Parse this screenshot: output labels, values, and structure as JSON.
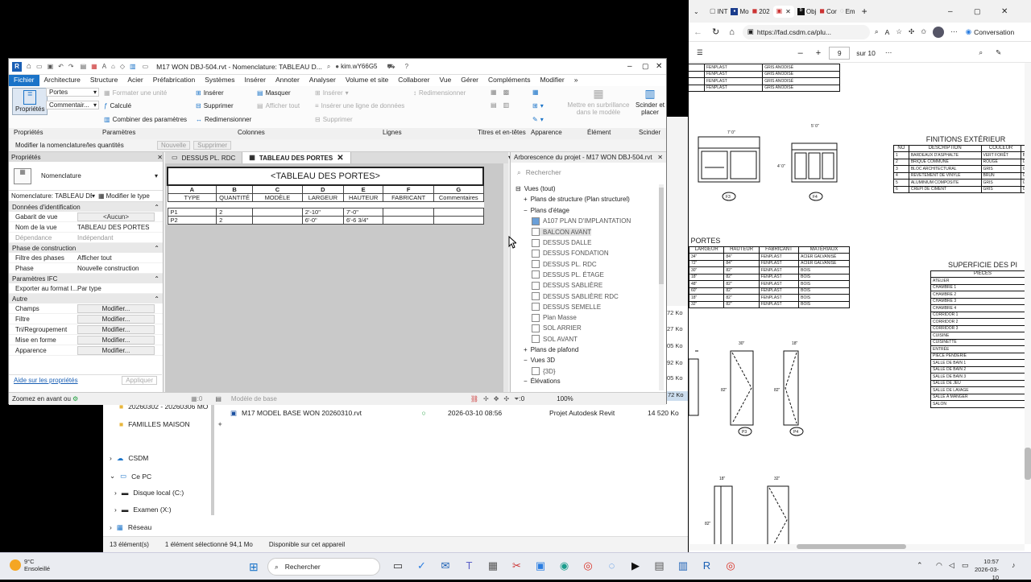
{
  "revit": {
    "title": "M17 WON DBJ-504.rvt - Nomenclature: TABLEAU D...",
    "user": "kim.wY66G5",
    "menu": [
      "Fichier",
      "Architecture",
      "Structure",
      "Acier",
      "Préfabrication",
      "Systèmes",
      "Insérer",
      "Annoter",
      "Analyser",
      "Volume et site",
      "Collaborer",
      "Vue",
      "Gérer",
      "Compléments",
      "Modifier"
    ],
    "ribbon": {
      "proprietes": "Propriétés",
      "portes": "Portes",
      "commentaires": "Commentair...",
      "formater_unite": "Formater une unité",
      "calcule": "Calculé",
      "combiner": "Combiner des paramètres",
      "inserer": "Insérer",
      "supprimer": "Supprimer",
      "redimensionner": "Redimensionner",
      "masquer": "Masquer",
      "afficher_tout": "Afficher tout",
      "inserer2": "Insérer",
      "inserer_ligne": "Insérer une ligne de données",
      "supprimer2": "Supprimer",
      "redimensionner2": "Redimensionner",
      "mettre_surbrillance": "Mettre en surbrillance dans le modèle",
      "scinder": "Scinder et placer"
    },
    "groups": [
      "Propriétés",
      "Paramètres",
      "Colonnes",
      "Lignes",
      "Titres et en-têtes",
      "Apparence",
      "Élément",
      "Scinder"
    ],
    "ctx": {
      "label": "Modifier la nomenclature/les quantités",
      "nouvelle": "Nouvelle",
      "supprimer": "Supprimer"
    },
    "props": {
      "header": "Propriétés",
      "type": "Nomenclature",
      "type_sel": "Nomenclature: TABLEAU DE",
      "modifier_type": "Modifier le type",
      "cats": [
        "Données d'identification",
        "Phase de construction",
        "Paramètres IFC",
        "Autre"
      ],
      "rows_id": [
        [
          "Gabarit de vue",
          "<Aucun>"
        ],
        [
          "Nom de la vue",
          "TABLEAU DES PORTES"
        ],
        [
          "Dépendance",
          "Indépendant"
        ]
      ],
      "rows_phase": [
        [
          "Filtre des phases",
          "Afficher tout"
        ],
        [
          "Phase",
          "Nouvelle construction"
        ]
      ],
      "rows_ifc": [
        [
          "Exporter au format I...",
          "Par type"
        ]
      ],
      "rows_autre": [
        [
          "Champs",
          "Modifier..."
        ],
        [
          "Filtre",
          "Modifier..."
        ],
        [
          "Tri/Regroupement",
          "Modifier..."
        ],
        [
          "Mise en forme",
          "Modifier..."
        ],
        [
          "Apparence",
          "Modifier..."
        ]
      ],
      "help": "Aide sur les propriétés",
      "apply": "Appliquer"
    },
    "tabs": [
      "DESSUS PL. RDC",
      "TABLEAU DES PORTES"
    ],
    "schedule": {
      "title": "<TABLEAU DES PORTES>",
      "letters": [
        "A",
        "B",
        "C",
        "D",
        "E",
        "F",
        "G"
      ],
      "headers": [
        "TYPE",
        "QUANTITÉ",
        "MODÈLE",
        "LARGEUR",
        "HAUTEUR",
        "FABRICANT",
        "Commentaires"
      ],
      "rows": [
        [
          "P1",
          "2",
          "",
          "2'-10\"",
          "7'-0\"",
          "",
          ""
        ],
        [
          "P2",
          "2",
          "",
          "6'-0\"",
          "6'-6 3/4\"",
          "",
          ""
        ]
      ]
    },
    "tree": {
      "title": "Arborescence du projet - M17 WON DBJ-504.rvt",
      "search": "Rechercher",
      "items": [
        "Vues (tout)",
        "Plans de structure (Plan structurel)",
        "Plans d'étage",
        "A107 PLAN D'IMPLANTATION",
        "BALCON AVANT",
        "DESSUS DALLE",
        "DESSUS FONDATION",
        "DESSUS PL. RDC",
        "DESSUS PL. ÉTAGE",
        "DESSUS SABLIÈRE",
        "DESSUS SABLIÈRE RDC",
        "DESSUS SEMELLE",
        "Plan Masse",
        "SOL ARRIER",
        "SOL AVANT",
        "Plans de plafond",
        "Vues 3D",
        "{3D}",
        "Élévations"
      ]
    },
    "status": {
      "left": "Zoomez en avant ou",
      "model": "Modèle de base",
      "zero1": ":0",
      "zero2": ":0",
      "zoom": "100%"
    }
  },
  "explorer": {
    "rows": [
      [
        "20260302 - 20260306 MO",
        ""
      ],
      [
        "FAMILLES MAISON",
        ""
      ]
    ],
    "file": {
      "name": "M17 MODEL BASE WON 20260310.rvt",
      "date": "2026-03-10 08:56",
      "type": "Projet Autodesk Revit",
      "size": "14 520 Ko"
    },
    "sizes": [
      "72 Ko",
      "27 Ko",
      "05 Ko",
      "92 Ko",
      "05 Ko",
      "68 Ko",
      "72 Ko"
    ],
    "nav": [
      "CSDM",
      "Ce PC",
      "Disque local (C:)",
      "Examen (X:)",
      "Réseau"
    ],
    "status": [
      "13 élément(s)",
      "1 élément sélectionné  94,1 Mo",
      "Disponible sur cet appareil"
    ]
  },
  "edge": {
    "tabs": [
      "INT",
      "Mo",
      "202",
      "",
      "Obj",
      "Cor",
      "Em"
    ],
    "url": "https://fad.csdm.ca/plu...",
    "conversation": "Conversation",
    "page": "9",
    "of": "sur 10"
  },
  "pdf": {
    "top_rows": [
      [
        "24\"",
        "FENPLAST",
        "GRIS ANODISÉ"
      ],
      [
        "66\"",
        "FENPLAST",
        "GRIS ANODISÉ"
      ],
      [
        "44\"",
        "FENPLAST",
        "GRIS ANODISÉ"
      ],
      [
        "48\"",
        "FENPLAST",
        "GRIS ANODISÉ"
      ]
    ],
    "finitions": {
      "title": "FINITIONS EXTÉRIEUR",
      "headers": [
        "NO",
        "DESCRIPTION",
        "COULEUR",
        "MA"
      ],
      "rows": [
        [
          "1",
          "BARDEAUX D'ASPHALTE",
          "VERT FORÊT",
          "BP"
        ],
        [
          "2",
          "BRIQUE COMMUNE",
          "ROUGE",
          "GEN"
        ],
        [
          "3",
          "BLOC ARCHITECTURAL",
          "GRIS",
          "GEN"
        ],
        [
          "4",
          "REVÊTEMENT DE VINYLE",
          "BRUN",
          "GEN"
        ],
        [
          "5",
          "ALUMINIUM COMPOSITE",
          "GRIS",
          "GEN"
        ],
        [
          "6",
          "CRÉPI DE CIMENT",
          "GRIS",
          "GR"
        ]
      ]
    },
    "portes": {
      "title": "PORTES",
      "headers": [
        "LARGEUR",
        "HAUTEUR",
        "FABRICANT",
        "MATÉRIAUX"
      ],
      "rows": [
        [
          "34\"",
          "84\"",
          "FENPLAST",
          "ACIER GALVANISÉ"
        ],
        [
          "72\"",
          "84\"",
          "FENPLAST",
          "ACIER GALVANISÉ"
        ],
        [
          "30\"",
          "82\"",
          "FENPLAST",
          "BOIS"
        ],
        [
          "18\"",
          "82\"",
          "FENPLAST",
          "BOIS"
        ],
        [
          "48\"",
          "82\"",
          "FENPLAST",
          "BOIS"
        ],
        [
          "60\"",
          "82\"",
          "FENPLAST",
          "BOIS"
        ],
        [
          "18\"",
          "82\"",
          "FENPLAST",
          "BOIS"
        ],
        [
          "32\"",
          "82\"",
          "FENPLAST",
          "BOIS"
        ]
      ]
    },
    "superficie": {
      "title": "SUPERFICIE DES PI",
      "header": "PIÈCES",
      "rows": [
        "ATELIER",
        "CHAMBRE 1",
        "CHAMBRE 2",
        "CHAMBRE 3",
        "CHAMBRE 4",
        "CORRIDOR 1",
        "CORRIDOR 2",
        "CORRIDOR 3",
        "CUISINE",
        "CUISINETTE",
        "ENTRÉE",
        "PIÈCE PENDERIE",
        "SALLE DE BAIN 1",
        "SALLE DE BAIN 2",
        "SALLE DE BAIN 3",
        "SALLE DE JEU",
        "SALLE DE LAVAGE",
        "SALLE À MANGER",
        "SALON"
      ]
    },
    "labels": [
      "F3",
      "F4",
      "P3",
      "P4"
    ],
    "dims": [
      "7' 0\"",
      "5' 0\"",
      "4' 0\"",
      "30\"",
      "18\"",
      "18\"",
      "32\"",
      "82\"",
      "82\"",
      "82\""
    ]
  },
  "taskbar": {
    "temp": "9°C",
    "weather": "Ensoleillé",
    "search": "Rechercher",
    "time": "10:57",
    "date": "2026-03-10"
  }
}
